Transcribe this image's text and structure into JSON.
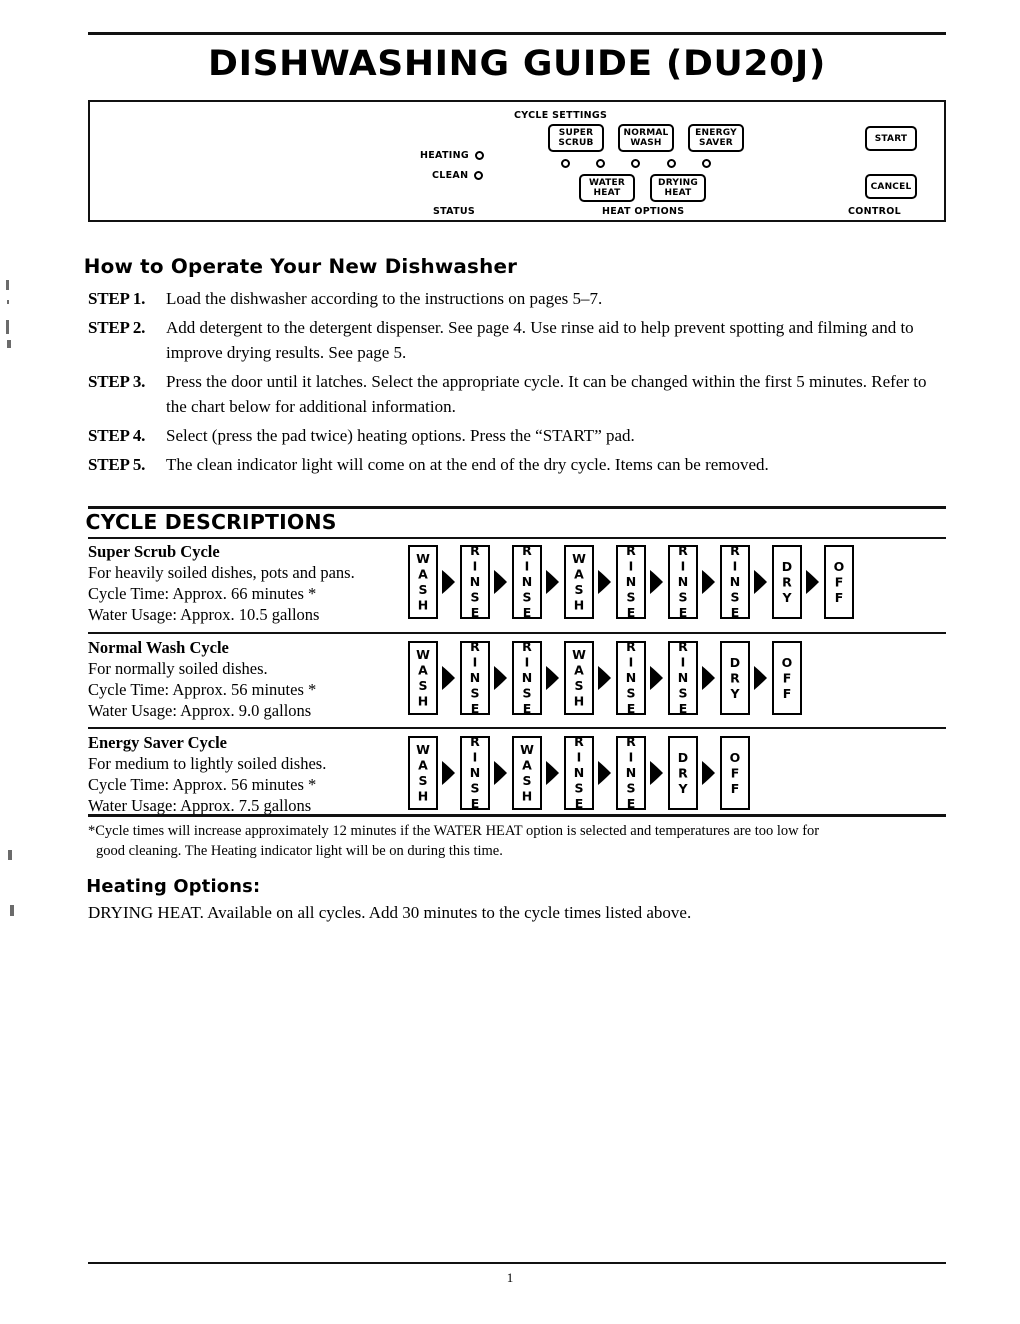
{
  "document": {
    "title": "DISHWASHING GUIDE (DU20J)",
    "page_number": "1"
  },
  "control_panel": {
    "cycle_settings_label": "CYCLE SETTINGS",
    "status_label": "STATUS",
    "heat_options_label": "HEAT OPTIONS",
    "control_label": "CONTROL",
    "indicators": [
      {
        "label": "HEATING",
        "icon": "indicator-circle"
      },
      {
        "label": "CLEAN",
        "icon": "indicator-circle"
      }
    ],
    "cycle_pads": [
      {
        "line1": "SUPER",
        "line2": "SCRUB"
      },
      {
        "line1": "NORMAL",
        "line2": "WASH"
      },
      {
        "line1": "ENERGY",
        "line2": "SAVER"
      }
    ],
    "heat_pads": [
      {
        "line1": "WATER",
        "line2": "HEAT"
      },
      {
        "line1": "DRYING",
        "line2": "HEAT"
      }
    ],
    "control_pads": [
      {
        "label": "START"
      },
      {
        "label": "CANCEL"
      }
    ],
    "led_count": 5
  },
  "how_to_operate": {
    "heading": "How to Operate Your New Dishwasher",
    "steps": [
      {
        "label": "STEP 1.",
        "text": "Load the dishwasher according to the instructions on pages 5–7."
      },
      {
        "label": "STEP 2.",
        "text": "Add detergent to the detergent dispenser. See page 4. Use rinse aid to help prevent spotting and filming and to improve drying results. See page 5."
      },
      {
        "label": "STEP 3.",
        "text": "Press the door until it latches. Select the appropriate cycle. It can be changed within the first 5 minutes. Refer to the chart below for additional information."
      },
      {
        "label": "STEP 4.",
        "text": "Select (press the pad twice) heating options. Press the “START” pad."
      },
      {
        "label": "STEP 5.",
        "text": "The clean indicator light will come on at the end of the dry cycle. Items can be removed."
      }
    ]
  },
  "cycle_descriptions": {
    "heading": "CYCLE DESCRIPTIONS",
    "cycles": [
      {
        "name": "Super Scrub Cycle",
        "description": "For heavily soiled dishes, pots and pans.",
        "cycle_time": "Cycle Time:  Approx. 66 minutes *",
        "water_usage": "Water Usage:  Approx. 10.5 gallons",
        "steps": [
          "WASH",
          "RINSE",
          "RINSE",
          "WASH",
          "RINSE",
          "RINSE",
          "RINSE",
          "DRY",
          "OFF"
        ]
      },
      {
        "name": "Normal Wash Cycle",
        "description": "For normally soiled dishes.",
        "cycle_time": "Cycle Time:  Approx. 56 minutes *",
        "water_usage": "Water Usage:  Approx. 9.0 gallons",
        "steps": [
          "WASH",
          "RINSE",
          "RINSE",
          "WASH",
          "RINSE",
          "RINSE",
          "DRY",
          "OFF"
        ]
      },
      {
        "name": "Energy Saver Cycle",
        "description": "For medium to lightly soiled dishes.",
        "cycle_time": "Cycle Time:  Approx. 56 minutes *",
        "water_usage": "Water Usage:  Approx. 7.5 gallons",
        "steps": [
          "WASH",
          "RINSE",
          "WASH",
          "RINSE",
          "RINSE",
          "DRY",
          "OFF"
        ]
      }
    ]
  },
  "footnote": {
    "line1": "*Cycle times will increase approximately 12 minutes if the WATER HEAT option is selected and temperatures are too low for",
    "line2": "good cleaning. The Heating indicator light will be on during this time."
  },
  "heating_options": {
    "heading": "Heating Options:",
    "text": "DRYING HEAT. Available on all cycles. Add 30 minutes to the cycle times listed above."
  }
}
